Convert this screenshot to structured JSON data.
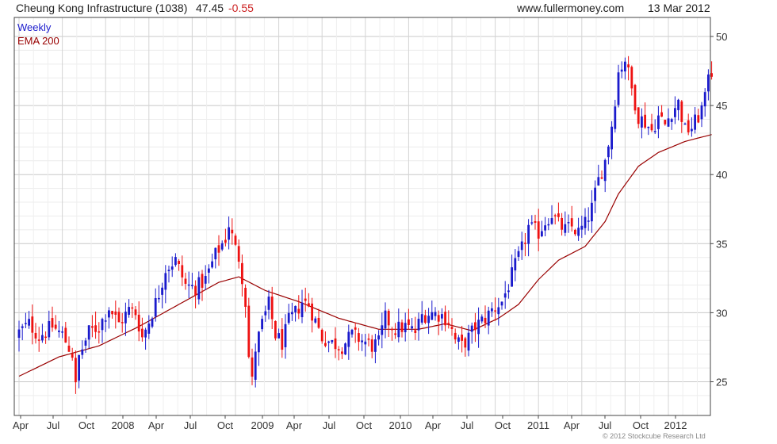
{
  "header": {
    "title": "Cheung Kong Infrastructure (1038)",
    "price": "47.45",
    "change": "-0.55",
    "website": "www.fullermoney.com",
    "date": "13 Mar 2012"
  },
  "copyright": "© 2012 Stockcube Research Ltd",
  "colors": {
    "up": "#1a1acc",
    "down": "#ee1111",
    "ema": "#990000",
    "grid": "#dddddd",
    "frame": "#444444"
  },
  "chart_data": {
    "type": "candlestick",
    "legend": [
      "Weekly",
      "EMA 200"
    ],
    "legend_placement": "top-left",
    "y_axis_side": "right",
    "ylim": [
      23,
      51
    ],
    "y_ticks": [
      25,
      30,
      35,
      40,
      45,
      50
    ],
    "x_ticks": [
      "Apr",
      "Jul",
      "Oct",
      "2008",
      "Apr",
      "Jul",
      "Oct",
      "2009",
      "Apr",
      "Jul",
      "Oct",
      "2010",
      "Apr",
      "Jul",
      "Oct",
      "2011",
      "Apr",
      "Jul",
      "Oct",
      "2012"
    ],
    "grid": true,
    "last_close": 47.45,
    "series": [
      {
        "name": "Weekly",
        "anchors": [
          {
            "week": 0,
            "close": 28.6
          },
          {
            "week": 3,
            "close": 29.2
          },
          {
            "week": 6,
            "close": 28.3
          },
          {
            "week": 10,
            "close": 29.0
          },
          {
            "week": 13,
            "close": 28.4
          },
          {
            "week": 16,
            "close": 27.0
          },
          {
            "week": 17,
            "close": 24.6
          },
          {
            "week": 18,
            "close": 26.8
          },
          {
            "week": 21,
            "close": 28.6
          },
          {
            "week": 24,
            "close": 29.0
          },
          {
            "week": 27,
            "close": 30.4
          },
          {
            "week": 30,
            "close": 29.2
          },
          {
            "week": 33,
            "close": 30.2
          },
          {
            "week": 35,
            "close": 30.0
          },
          {
            "week": 37,
            "close": 28.2
          },
          {
            "week": 39,
            "close": 29.4
          },
          {
            "week": 42,
            "close": 31.4
          },
          {
            "week": 44,
            "close": 33.2
          },
          {
            "week": 47,
            "close": 33.8
          },
          {
            "week": 50,
            "close": 32.0
          },
          {
            "week": 53,
            "close": 31.8
          },
          {
            "week": 56,
            "close": 32.4
          },
          {
            "week": 59,
            "close": 34.2
          },
          {
            "week": 62,
            "close": 35.4
          },
          {
            "week": 63,
            "close": 36.4
          },
          {
            "week": 65,
            "close": 34.6
          },
          {
            "week": 66,
            "close": 34.0
          },
          {
            "week": 67,
            "close": 32.6
          },
          {
            "week": 68,
            "close": 30.8
          },
          {
            "week": 69,
            "close": 26.8
          },
          {
            "week": 70,
            "close": 25.0
          },
          {
            "week": 71,
            "close": 27.4
          },
          {
            "week": 73,
            "close": 29.2
          },
          {
            "week": 75,
            "close": 30.6
          },
          {
            "week": 77,
            "close": 28.4
          },
          {
            "week": 79,
            "close": 27.8
          },
          {
            "week": 81,
            "close": 29.4
          },
          {
            "week": 83,
            "close": 30.0
          },
          {
            "week": 85,
            "close": 30.8
          },
          {
            "week": 87,
            "close": 30.6
          },
          {
            "week": 89,
            "close": 29.4
          },
          {
            "week": 91,
            "close": 28.2
          },
          {
            "week": 94,
            "close": 27.8
          },
          {
            "week": 97,
            "close": 27.6
          },
          {
            "week": 100,
            "close": 28.4
          },
          {
            "week": 103,
            "close": 28.0
          },
          {
            "week": 106,
            "close": 27.6
          },
          {
            "week": 108,
            "close": 27.8
          },
          {
            "week": 110,
            "close": 29.6
          },
          {
            "week": 113,
            "close": 28.8
          },
          {
            "week": 116,
            "close": 29.0
          },
          {
            "week": 119,
            "close": 28.6
          },
          {
            "week": 121,
            "close": 29.8
          },
          {
            "week": 124,
            "close": 30.0
          },
          {
            "week": 127,
            "close": 29.8
          },
          {
            "week": 129,
            "close": 29.4
          },
          {
            "week": 131,
            "close": 28.0
          },
          {
            "week": 133,
            "close": 27.6
          },
          {
            "week": 135,
            "close": 28.2
          },
          {
            "week": 137,
            "close": 29.0
          },
          {
            "week": 140,
            "close": 29.6
          },
          {
            "week": 142,
            "close": 30.2
          },
          {
            "week": 145,
            "close": 30.8
          },
          {
            "week": 147,
            "close": 32.0
          },
          {
            "week": 149,
            "close": 33.4
          },
          {
            "week": 151,
            "close": 34.6
          },
          {
            "week": 153,
            "close": 36.2
          },
          {
            "week": 156,
            "close": 35.8
          },
          {
            "week": 158,
            "close": 36.6
          },
          {
            "week": 160,
            "close": 37.2
          },
          {
            "week": 162,
            "close": 36.4
          },
          {
            "week": 164,
            "close": 36.0
          },
          {
            "week": 166,
            "close": 36.2
          },
          {
            "week": 168,
            "close": 35.8
          },
          {
            "week": 170,
            "close": 36.4
          },
          {
            "week": 172,
            "close": 37.6
          },
          {
            "week": 174,
            "close": 39.6
          },
          {
            "week": 176,
            "close": 41.0
          },
          {
            "week": 178,
            "close": 43.6
          },
          {
            "week": 180,
            "close": 47.4
          },
          {
            "week": 182,
            "close": 48.4
          },
          {
            "week": 184,
            "close": 46.2
          },
          {
            "week": 186,
            "close": 44.2
          },
          {
            "week": 188,
            "close": 43.8
          },
          {
            "week": 190,
            "close": 43.2
          },
          {
            "week": 192,
            "close": 44.2
          },
          {
            "week": 194,
            "close": 43.6
          },
          {
            "week": 196,
            "close": 44.6
          },
          {
            "week": 198,
            "close": 45.2
          },
          {
            "week": 200,
            "close": 43.2
          },
          {
            "week": 202,
            "close": 43.4
          },
          {
            "week": 204,
            "close": 44.2
          },
          {
            "week": 206,
            "close": 45.4
          },
          {
            "week": 207,
            "close": 47.6
          },
          {
            "week": 208,
            "close": 47.45
          }
        ]
      },
      {
        "name": "EMA 200",
        "anchors": [
          {
            "week": 0,
            "close": 25.4
          },
          {
            "week": 12,
            "close": 26.8
          },
          {
            "week": 24,
            "close": 27.6
          },
          {
            "week": 36,
            "close": 29.0
          },
          {
            "week": 48,
            "close": 30.6
          },
          {
            "week": 60,
            "close": 32.2
          },
          {
            "week": 66,
            "close": 32.6
          },
          {
            "week": 74,
            "close": 31.6
          },
          {
            "week": 84,
            "close": 30.8
          },
          {
            "week": 96,
            "close": 29.6
          },
          {
            "week": 108,
            "close": 28.8
          },
          {
            "week": 120,
            "close": 28.8
          },
          {
            "week": 128,
            "close": 29.2
          },
          {
            "week": 136,
            "close": 28.7
          },
          {
            "week": 144,
            "close": 29.6
          },
          {
            "week": 150,
            "close": 30.6
          },
          {
            "week": 156,
            "close": 32.4
          },
          {
            "week": 162,
            "close": 33.8
          },
          {
            "week": 170,
            "close": 34.8
          },
          {
            "week": 176,
            "close": 36.6
          },
          {
            "week": 180,
            "close": 38.6
          },
          {
            "week": 186,
            "close": 40.6
          },
          {
            "week": 192,
            "close": 41.6
          },
          {
            "week": 200,
            "close": 42.4
          },
          {
            "week": 208,
            "close": 42.9
          }
        ]
      }
    ]
  }
}
